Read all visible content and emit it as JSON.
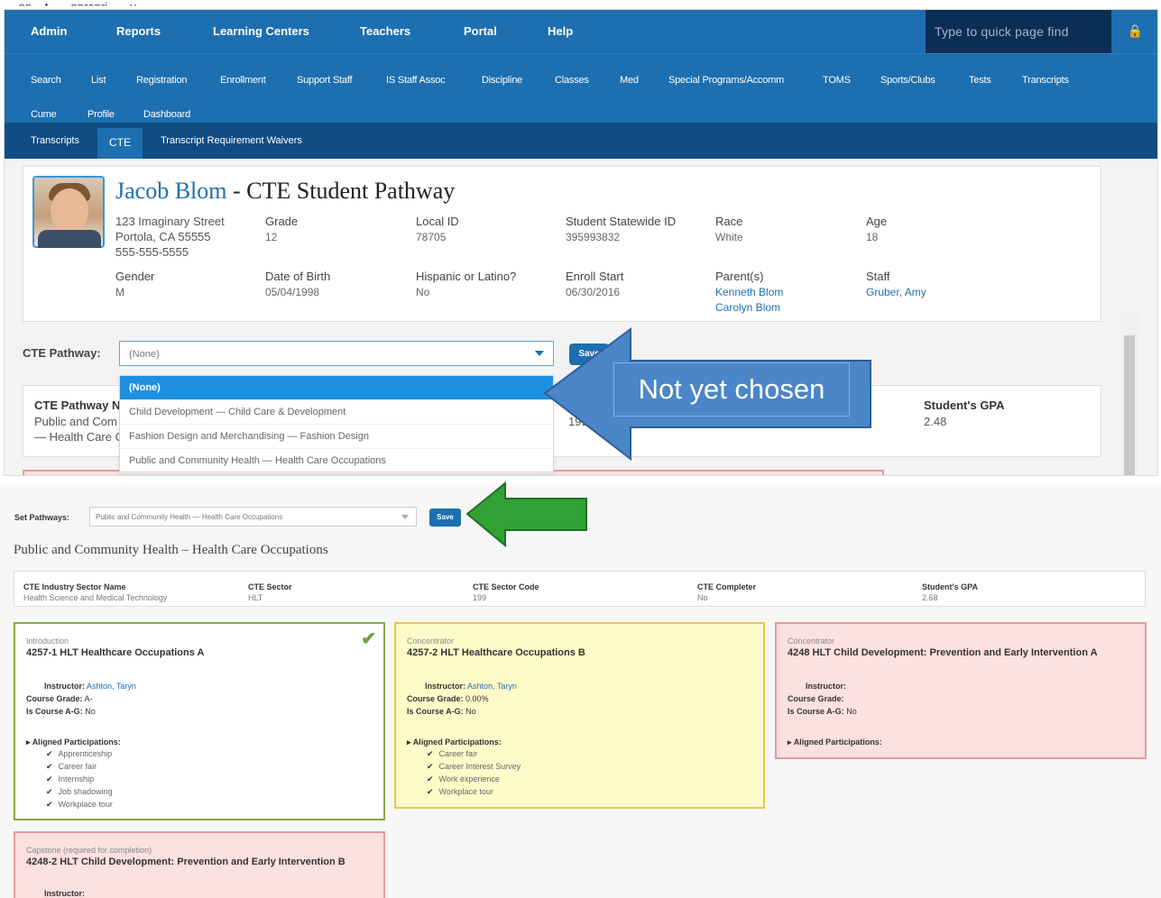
{
  "caption_fragment": "...pp... t... ...ppropri... ...y",
  "nav": {
    "main": [
      "Admin",
      "Reports",
      "Learning Centers",
      "Teachers",
      "Portal",
      "Help"
    ],
    "quickfind_placeholder": "Type to quick page find",
    "sub_row1": [
      "Search",
      "List",
      "Registration",
      "Enrollment",
      "Support Staff",
      "IS Staff Assoc",
      "Discipline",
      "Classes",
      "Med",
      "Special Programs/Accomm",
      "TOMS",
      "Sports/Clubs",
      "Tests",
      "Transcripts"
    ],
    "sub_row2": [
      "Cume",
      "Profile",
      "Dashboard"
    ],
    "tabs": [
      "Transcripts",
      "CTE",
      "Transcript Requirement Waivers"
    ]
  },
  "student": {
    "name": "Jacob Blom",
    "title_suffix": " - CTE Student Pathway",
    "address": [
      "123 Imaginary Street",
      "Portola, CA 55555",
      "555-555-5555"
    ],
    "fields": [
      {
        "label": "Grade",
        "value": "12"
      },
      {
        "label": "Local ID",
        "value": "78705"
      },
      {
        "label": "Student Statewide ID",
        "value": "395993832"
      },
      {
        "label": "Race",
        "value": "White"
      },
      {
        "label": "Age",
        "value": "18"
      },
      {
        "label": "Gender",
        "value": "M"
      },
      {
        "label": "Date of Birth",
        "value": "05/04/1998"
      },
      {
        "label": "Hispanic or Latino?",
        "value": "No"
      },
      {
        "label": "Enroll Start",
        "value": "06/30/2016"
      }
    ],
    "parents_label": "Parent(s)",
    "parents": [
      "Kenneth Blom",
      "Carolyn Blom"
    ],
    "staff_label": "Staff",
    "staff": "Gruber, Amy"
  },
  "pathway": {
    "label": "CTE Pathway:",
    "selected": "(None)",
    "save": "Save",
    "options": [
      "(None)",
      "Child Development — Child Care & Development",
      "Fashion Design and Merchandising — Fashion Design",
      "Public and Community Health — Health Care Occupations"
    ],
    "behind_label": "CTE Pathway N",
    "behind_value": [
      "Public and Com",
      "— Health Care O"
    ],
    "behind_c": "C",
    "behind_code": "199",
    "gpa_label": "Student's GPA",
    "gpa_value": "2.48"
  },
  "callout_blue": "Not yet chosen",
  "bottom": {
    "set_label": "Set Pathways:",
    "set_value": "Public and Community Health — Health Care Occupations",
    "save": "Save",
    "heading": "Public and Community Health – Health Care Occupations",
    "info": [
      {
        "label": "CTE Industry Sector Name",
        "value": "Health Science and Medical Technology"
      },
      {
        "label": "CTE Sector",
        "value": "HLT"
      },
      {
        "label": "CTE Sector Code",
        "value": "199"
      },
      {
        "label": "CTE Completer",
        "value": "No"
      },
      {
        "label": "Student's GPA",
        "value": "2.68"
      }
    ],
    "courses": [
      {
        "level": "Introduction",
        "title": "4257-1 HLT Healthcare Occupations A",
        "instructor_label": "Instructor:",
        "instructor": "Ashton, Taryn",
        "grade_label": "Course Grade:",
        "grade": "A-",
        "ag_label": "Is Course A-G:",
        "ag": "No",
        "aligned_label": "Aligned Participations:",
        "items": [
          "Apprenticeship",
          "Career fair",
          "Internship",
          "Job shadowing",
          "Workplace tour"
        ]
      },
      {
        "level": "Concentrator",
        "title": "4257-2 HLT Healthcare Occupations B",
        "instructor_label": "Instructor:",
        "instructor": "Ashton, Taryn",
        "grade_label": "Course Grade:",
        "grade": "0.00%",
        "ag_label": "Is Course A-G:",
        "ag": "No",
        "aligned_label": "Aligned Participations:",
        "items": [
          "Career fair",
          "Career Interest Survey",
          "Work experience",
          "Workplace tour"
        ]
      },
      {
        "level": "Concentrator",
        "title": "4248 HLT Child Development: Prevention and Early Intervention A",
        "instructor_label": "Instructor:",
        "instructor": "",
        "grade_label": "Course Grade:",
        "grade": "",
        "ag_label": "Is Course A-G:",
        "ag": "No",
        "aligned_label": "Aligned Participations:",
        "items": []
      },
      {
        "level": "Capstone (required for completion)",
        "title": "4248-2 HLT Child Development: Prevention and Early Intervention B",
        "instructor_label": "Instructor:",
        "instructor": "",
        "grade_label": "",
        "grade": "",
        "ag_label": "",
        "ag": "",
        "aligned_label": "",
        "items": []
      }
    ]
  },
  "colors": {
    "nav": "#1d6fb0",
    "nav_dark": "#0b2e55",
    "arrow_blue": "#4a86c8",
    "arrow_green": "#2fa135"
  }
}
